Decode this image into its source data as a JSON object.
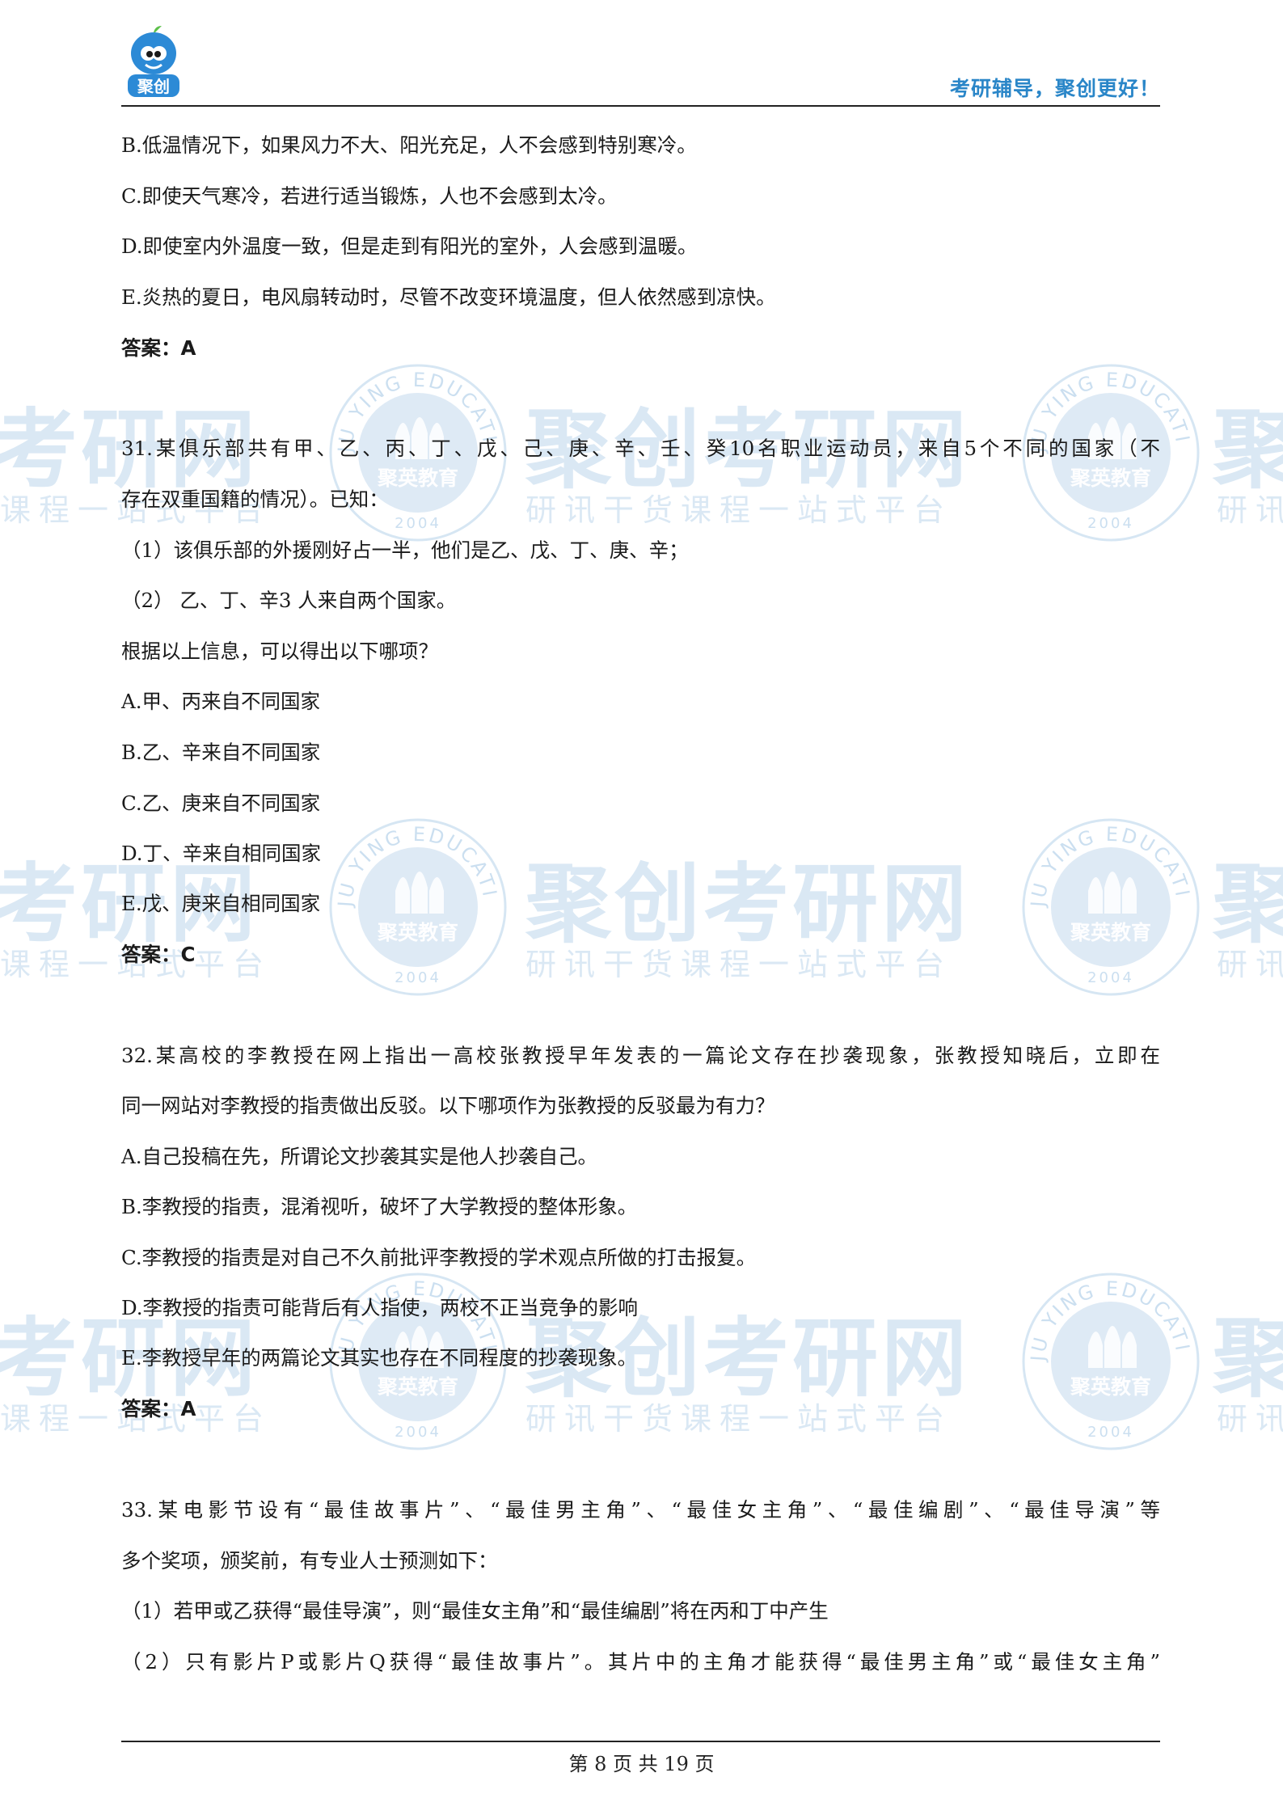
{
  "header": {
    "tagline": "考研辅导，聚创更好！",
    "logo_text": "聚创"
  },
  "watermark": {
    "brand": "聚创考研网",
    "slogan": "研讯干货课程一站式平台",
    "seal_top": "JU YING EDUCATION",
    "seal_center": "聚英教育",
    "seal_year": "2004",
    "brand_left": "考研网",
    "slogan_left": "课程一站式平台",
    "brand_right": "聚",
    "slogan_right": "研讯"
  },
  "q30_options": {
    "b": "B.低温情况下，如果风力不大、阳光充足，人不会感到特别寒冷。",
    "c": "C.即使天气寒冷，若进行适当锻炼，人也不会感到太冷。",
    "d": "D.即使室内外温度一致，但是走到有阳光的室外，人会感到温暖。",
    "e": "E.炎热的夏日，电风扇转动时，尽管不改变环境温度，但人依然感到凉快。",
    "answer": "答案：A"
  },
  "q31": {
    "stem_1": "31.某俱乐部共有甲、乙、丙、丁、戊、己、庚、辛、壬、癸10名职业运动员，来自5个不同的国家（不",
    "stem_2": "存在双重国籍的情况）。已知：",
    "cond_1": "（1）该俱乐部的外援刚好占一半，他们是乙、戊、丁、庚、辛；",
    "cond_2": "（2）  乙、丁、辛3 人来自两个国家。",
    "ask": "根据以上信息，可以得出以下哪项？",
    "a": "A.甲、丙来自不同国家",
    "b": "B.乙、辛来自不同国家",
    "c": "C.乙、庚来自不同国家",
    "d": "D.丁、辛来自相同国家",
    "e": "E.戊、庚来自相同国家",
    "answer": "答案：C"
  },
  "q32": {
    "stem_1": "32.某高校的李教授在网上指出一高校张教授早年发表的一篇论文存在抄袭现象，张教授知晓后，立即在",
    "stem_2": "同一网站对李教授的指责做出反驳。以下哪项作为张教授的反驳最为有力？",
    "a": "A.自己投稿在先，所谓论文抄袭其实是他人抄袭自己。",
    "b": "B.李教授的指责，混淆视听，破坏了大学教授的整体形象。",
    "c": "C.李教授的指责是对自己不久前批评李教授的学术观点所做的打击报复。",
    "d": "D.李教授的指责可能背后有人指使，两校不正当竞争的影响",
    "e": "E.李教授早年的两篇论文其实也存在不同程度的抄袭现象。",
    "answer": "答案：A"
  },
  "q33": {
    "stem_1": "33.某电影节设有“最佳故事片”、“最佳男主角”、“最佳女主角”、“最佳编剧”、“最佳导演”等",
    "stem_2": "多个奖项，颁奖前，有专业人士预测如下：",
    "cond_1": "（1）若甲或乙获得“最佳导演”，则“最佳女主角”和“最佳编剧”将在丙和丁中产生",
    "cond_2": "（2）只有影片P或影片Q获得“最佳故事片”。其片中的主角才能获得“最佳男主角”或“最佳女主角”"
  },
  "footer": {
    "page_text": "第 8 页 共 19 页"
  }
}
